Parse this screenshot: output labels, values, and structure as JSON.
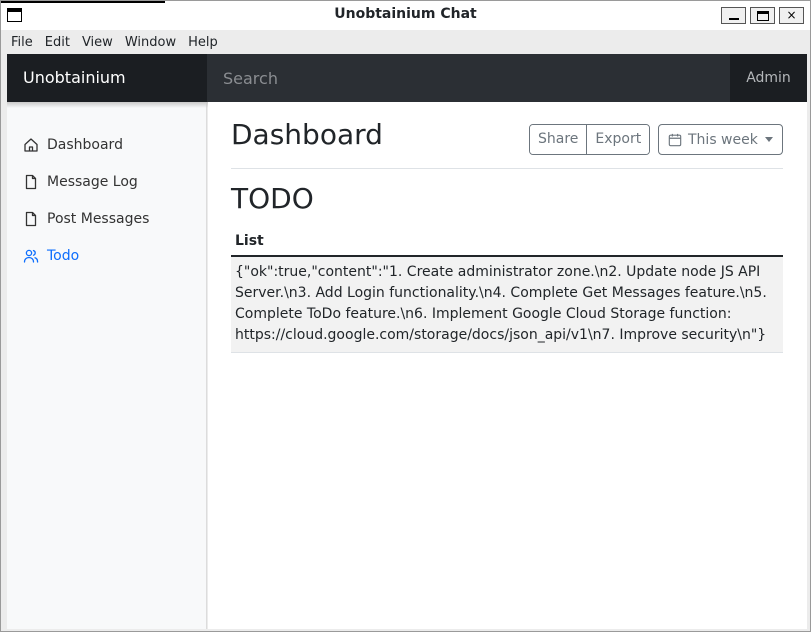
{
  "window": {
    "title": "Unobtainium Chat",
    "controls": {
      "minimize": "minimize",
      "maximize": "maximize",
      "close": "×"
    }
  },
  "menu": [
    "File",
    "Edit",
    "View",
    "Window",
    "Help"
  ],
  "navbar": {
    "brand": "Unobtainium",
    "search_placeholder": "Search",
    "user": "Admin"
  },
  "sidebar": {
    "items": [
      {
        "label": "Dashboard",
        "icon": "home-icon",
        "active": false
      },
      {
        "label": "Message Log",
        "icon": "file-icon",
        "active": false
      },
      {
        "label": "Post Messages",
        "icon": "file-icon",
        "active": false
      },
      {
        "label": "Todo",
        "icon": "users-icon",
        "active": true
      }
    ]
  },
  "main": {
    "title": "Dashboard",
    "share_label": "Share",
    "export_label": "Export",
    "week_label": "This week",
    "section_title": "TODO",
    "table": {
      "header": "List",
      "cell": "{\"ok\":true,\"content\":\"1. Create administrator zone.\\n2. Update node JS API Server.\\n3. Add Login functionality.\\n4. Complete Get Messages feature.\\n5. Complete ToDo feature.\\n6. Implement Google Cloud Storage function: https://cloud.google.com/storage/docs/json_api/v1\\n7. Improve security\\n\"}"
    }
  },
  "colors": {
    "navbar": "#212529",
    "accent": "#0d6efd",
    "sidebar_bg": "#f8f9fa"
  }
}
